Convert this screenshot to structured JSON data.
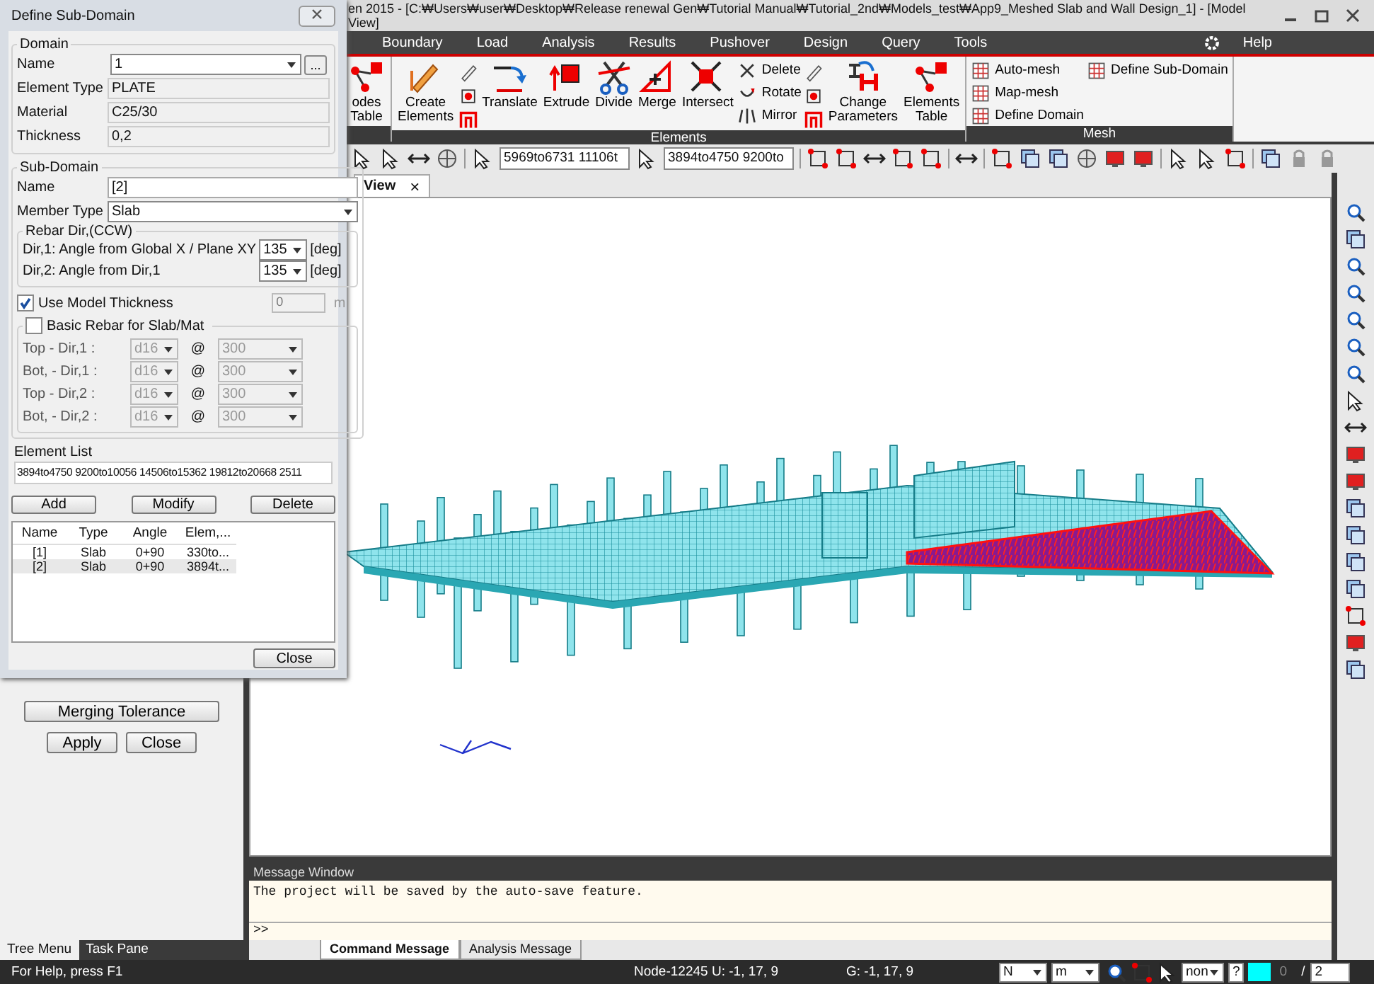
{
  "window": {
    "title": "en 2015 - [C:₩Users₩user₩Desktop₩Release renewal Gen₩Tutorial Manual₩Tutorial_2nd₩Models_test₩App9_Meshed Slab and Wall Design_1] - [Model View]"
  },
  "menu": [
    {
      "label": "Boundary"
    },
    {
      "label": "Load"
    },
    {
      "label": "Analysis"
    },
    {
      "label": "Results"
    },
    {
      "label": "Pushover"
    },
    {
      "label": "Design"
    },
    {
      "label": "Query"
    },
    {
      "label": "Tools"
    }
  ],
  "help": "Help",
  "ribbon": {
    "groups": [
      {
        "items": [
          {
            "kind": "large",
            "label": "odes Table"
          }
        ]
      },
      {
        "label": "Elements",
        "items": [
          {
            "kind": "large",
            "label": "Create Elements"
          },
          {
            "kind": "icons"
          },
          {
            "kind": "large",
            "label": "Translate"
          },
          {
            "kind": "large",
            "label": "Extrude"
          },
          {
            "kind": "large",
            "label": "Divide"
          },
          {
            "kind": "large",
            "label": "Merge"
          },
          {
            "kind": "large",
            "label": "Intersect"
          },
          {
            "kind": "stack",
            "buttons": [
              {
                "label": "Delete"
              },
              {
                "label": "Rotate"
              },
              {
                "label": "Mirror"
              }
            ]
          },
          {
            "kind": "icons"
          },
          {
            "kind": "large",
            "label": "Change Parameters"
          },
          {
            "kind": "large",
            "label": "Elements Table"
          }
        ]
      },
      {
        "label": "Mesh",
        "items": [
          {
            "kind": "stack",
            "buttons": [
              {
                "label": "Auto-mesh"
              },
              {
                "label": "Map-mesh"
              },
              {
                "label": "Define Domain"
              }
            ]
          },
          {
            "kind": "stack",
            "buttons": [
              {
                "label": "Define Sub-Domain"
              }
            ]
          }
        ]
      }
    ]
  },
  "toolbar": {
    "selection_fields": [
      "5969to6731 11106t",
      "3894to4750 9200to"
    ]
  },
  "view_tab": {
    "label": "View",
    "close": "×"
  },
  "dialog": {
    "title": "Define Sub-Domain",
    "domain": {
      "label": "Domain",
      "fields": [
        {
          "kind": "combo",
          "label": "Name",
          "value": "1",
          "browse": "..."
        },
        {
          "kind": "readonly",
          "label": "Element Type",
          "value": "PLATE"
        },
        {
          "kind": "readonly",
          "label": "Material",
          "value": "C25/30"
        },
        {
          "kind": "readonly",
          "label": "Thickness",
          "value": "0,2"
        }
      ]
    },
    "sub_domain": {
      "label": "Sub-Domain",
      "name": {
        "label": "Name",
        "value": "[2]"
      },
      "member_type": {
        "label": "Member Type",
        "value": "Slab"
      },
      "rebar_dir": {
        "label": "Rebar Dir,(CCW)",
        "rows": [
          {
            "label": "Dir,1: Angle from Global X / Plane XY",
            "value": "135",
            "unit": "[deg]"
          },
          {
            "label": "Dir,2: Angle from Dir,1",
            "value": "135",
            "unit": "[deg]"
          }
        ]
      },
      "use_model_thickness": {
        "label": "Use Model Thickness",
        "checked": true,
        "value": "0",
        "unit": "m"
      },
      "basic_rebar": {
        "label": "Basic Rebar for Slab/Mat",
        "checked": false,
        "rows": [
          {
            "label": "Top - Dir,1 :",
            "bar": "d16",
            "at": "@",
            "spacing": "300"
          },
          {
            "label": "Bot, - Dir,1 :",
            "bar": "d16",
            "at": "@",
            "spacing": "300"
          },
          {
            "label": "Top - Dir,2 :",
            "bar": "d16",
            "at": "@",
            "spacing": "300"
          },
          {
            "label": "Bot, - Dir,2 :",
            "bar": "d16",
            "at": "@",
            "spacing": "300"
          }
        ]
      }
    },
    "element_list": {
      "label": "Element List",
      "value": "3894to4750 9200to10056 14506to15362 19812to20668 2511"
    },
    "buttons": [
      "Add",
      "Modify",
      "Delete"
    ],
    "table": {
      "columns": [
        "Name",
        "Type",
        "Angle",
        "Elem,..."
      ],
      "rows": [
        {
          "cells": [
            "[1]",
            "Slab",
            "0+90",
            "330to..."
          ],
          "selected": false
        },
        {
          "cells": [
            "[2]",
            "Slab",
            "0+90",
            "3894t..."
          ],
          "selected": true
        }
      ]
    },
    "close": "Close"
  },
  "left_panel": {
    "merging_tolerance": "Merging Tolerance",
    "apply": "Apply",
    "close": "Close",
    "tabs": [
      {
        "label": "Tree Menu",
        "selected": true
      },
      {
        "label": "Task Pane",
        "selected": false
      }
    ]
  },
  "message_window": {
    "title": "Message Window",
    "lines": [
      "The project will be saved by the auto-save feature."
    ],
    "prompt": ">>",
    "tabs": [
      {
        "label": "Command Message",
        "selected": true
      },
      {
        "label": "Analysis Message",
        "selected": false
      }
    ]
  },
  "status_bar": {
    "help": "For Help, press F1",
    "node": "Node-12245",
    "u": "U: -1, 17, 9",
    "g": "G: -1, 17, 9",
    "force_unit": "N",
    "length_unit": "m",
    "filter": "non",
    "query": "?",
    "page": "0",
    "separator": "/",
    "total": "2"
  }
}
